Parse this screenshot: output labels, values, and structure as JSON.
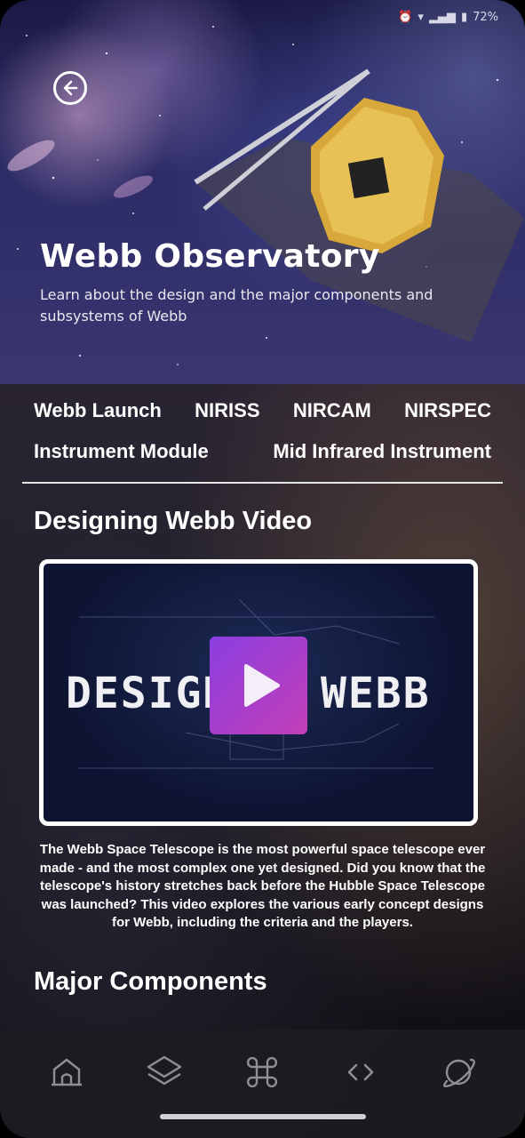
{
  "status_bar": {
    "battery": "72%"
  },
  "hero": {
    "title": "Webb Observatory",
    "subtitle": "Learn about the design and the major components and subsystems of Webb"
  },
  "chips": {
    "row1": [
      "Webb Launch",
      "NIRISS",
      "NIRCAM",
      "NIRSPEC"
    ],
    "row2": [
      "Instrument Module",
      "Mid Infrared Instrument"
    ]
  },
  "video_section": {
    "title": "Designing Webb Video",
    "thumbnail_left": "DESIGN",
    "thumbnail_right": "WEBB",
    "description": "The Webb Space Telescope is the most powerful space telescope ever made - and the most complex one yet designed. Did you know that the telescope's history stretches back before the Hubble Space Telescope was launched? This video explores the various early concept designs for Webb, including the criteria and the players."
  },
  "major_components": {
    "title": "Major Components"
  },
  "bottom_nav": [
    "home-icon",
    "layers-icon",
    "command-icon",
    "code-icon",
    "planet-icon"
  ],
  "colors": {
    "play_gradient_start": "#8b3ee0",
    "play_gradient_end": "#c23fb7",
    "nav_bg": "#1c1c20"
  }
}
